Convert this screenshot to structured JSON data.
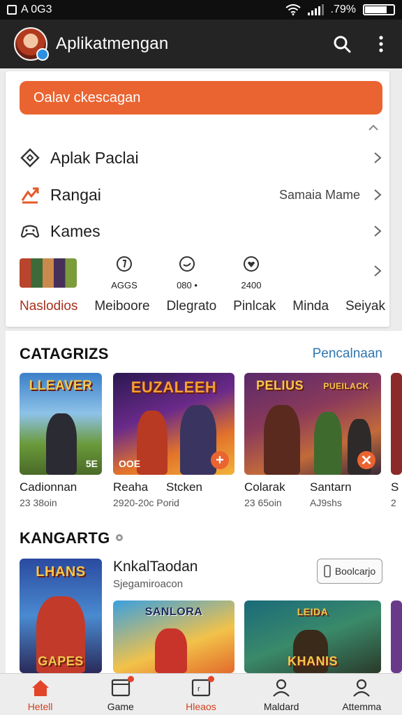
{
  "status_bar": {
    "left_text": "A 0G3",
    "battery_text": ".79%",
    "battery_level": 0.79
  },
  "app_bar": {
    "title": "Aplikatmengan"
  },
  "top_card": {
    "cta_label": "Oalav ckescagan",
    "rows": [
      {
        "label": "Aplak Paclai",
        "value": ""
      },
      {
        "label": "Rangai",
        "value": "Samaia Mame"
      },
      {
        "label": "Kames",
        "value": ""
      }
    ],
    "mini_stats": [
      "AGGS",
      "080 •",
      "2400"
    ],
    "tabs": [
      "Naslodios",
      "Meiboore",
      "Dlegrato",
      "Pinlcak",
      "Minda",
      "Seiyak"
    ],
    "active_tab": 0
  },
  "categories": {
    "title": "CATAGRIZS",
    "link": "Pencalnaan",
    "items": [
      {
        "art": "LLEAVER",
        "name": "Cadionnan",
        "meta": "23 38oin",
        "tag": "5E"
      },
      {
        "art": "EUZALEEH",
        "name": "Reaha",
        "name2": "Stcken",
        "meta": "2920-20c Porid",
        "tag": "OOE"
      },
      {
        "art": "PELIUS",
        "art2": "PUEILACK",
        "name": "Colarak",
        "name2": "Santarn",
        "meta": "23 65oin",
        "meta2": "AJ9shs"
      },
      {
        "name": "S",
        "meta": "2"
      }
    ]
  },
  "featured": {
    "title": "KANGARTG",
    "item_title": "KnkalTaodan",
    "item_sub": "Sjegamiroacon",
    "button_label": "Boolcarjo",
    "thumbs": [
      "LHANS",
      "GAPES",
      "SANLORA",
      "LEIDA",
      "KHANIS"
    ]
  },
  "bottom_nav": [
    {
      "label": "Hetell",
      "active": true
    },
    {
      "label": "Game",
      "active": false
    },
    {
      "label": "Hleaos",
      "active": false
    },
    {
      "label": "Maldard",
      "active": false
    },
    {
      "label": "Attemma",
      "active": false
    }
  ],
  "colors": {
    "accent": "#ea6431",
    "link": "#2f76b0",
    "appbar": "#242424",
    "active_tab": "#a8301c"
  }
}
